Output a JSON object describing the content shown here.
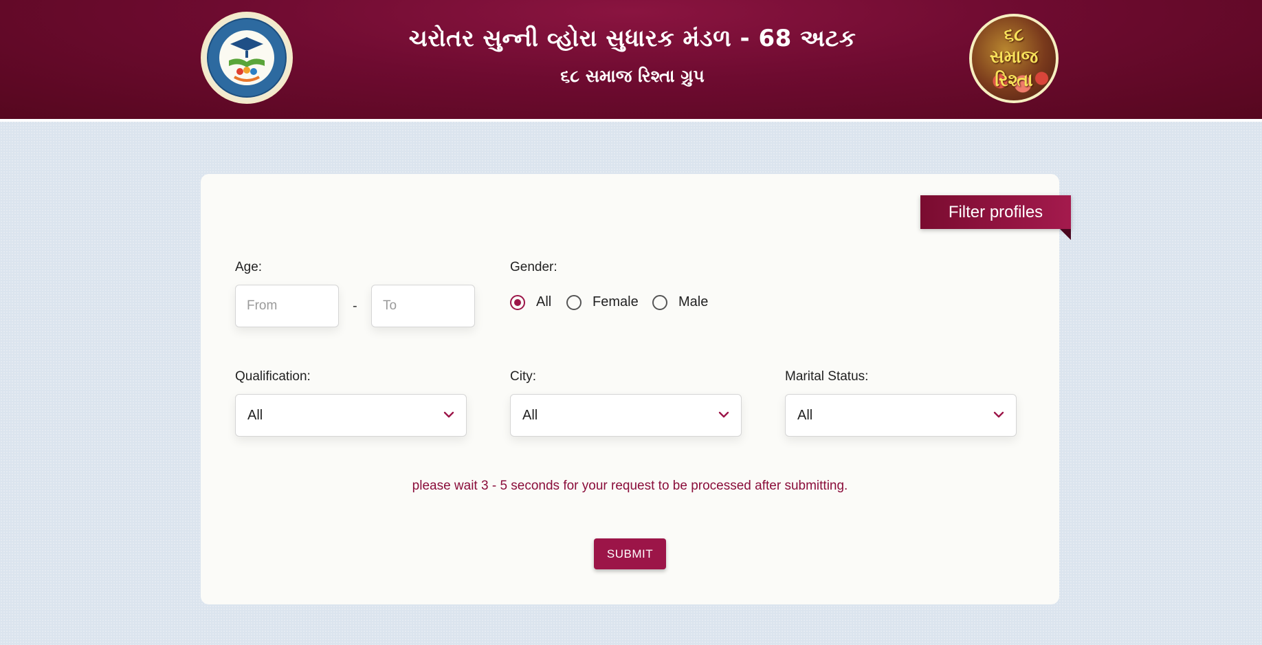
{
  "header": {
    "title": "ચરોતર સુન્ની વ્હોરા સુધારક મંડળ - 68 અટક",
    "subtitle": "૬૮ સમાજ રિશ્તા ગ્રુપ",
    "right_logo": {
      "line1": "૬૮",
      "line2": "સમાજ",
      "line3": "રિશ્તા"
    }
  },
  "filter": {
    "ribbon_label": "Filter profiles",
    "age": {
      "label": "Age:",
      "from_placeholder": "From",
      "to_placeholder": "To",
      "separator": "-"
    },
    "gender": {
      "label": "Gender:",
      "options": [
        "All",
        "Female",
        "Male"
      ],
      "selected": "All"
    },
    "qualification": {
      "label": "Qualification:",
      "value": "All"
    },
    "city": {
      "label": "City:",
      "value": "All"
    },
    "marital_status": {
      "label": "Marital Status:",
      "value": "All"
    },
    "notice": "please wait 3 - 5 seconds for your request to be processed after submitting.",
    "submit_label": "SUBMIT"
  },
  "colors": {
    "brand": "#6e0b30",
    "accent": "#9c1548",
    "notice_text": "#8a0d3a",
    "page_bg": "#dbe4ee"
  },
  "icons": {
    "select_chevron": "chevron-down-icon"
  }
}
